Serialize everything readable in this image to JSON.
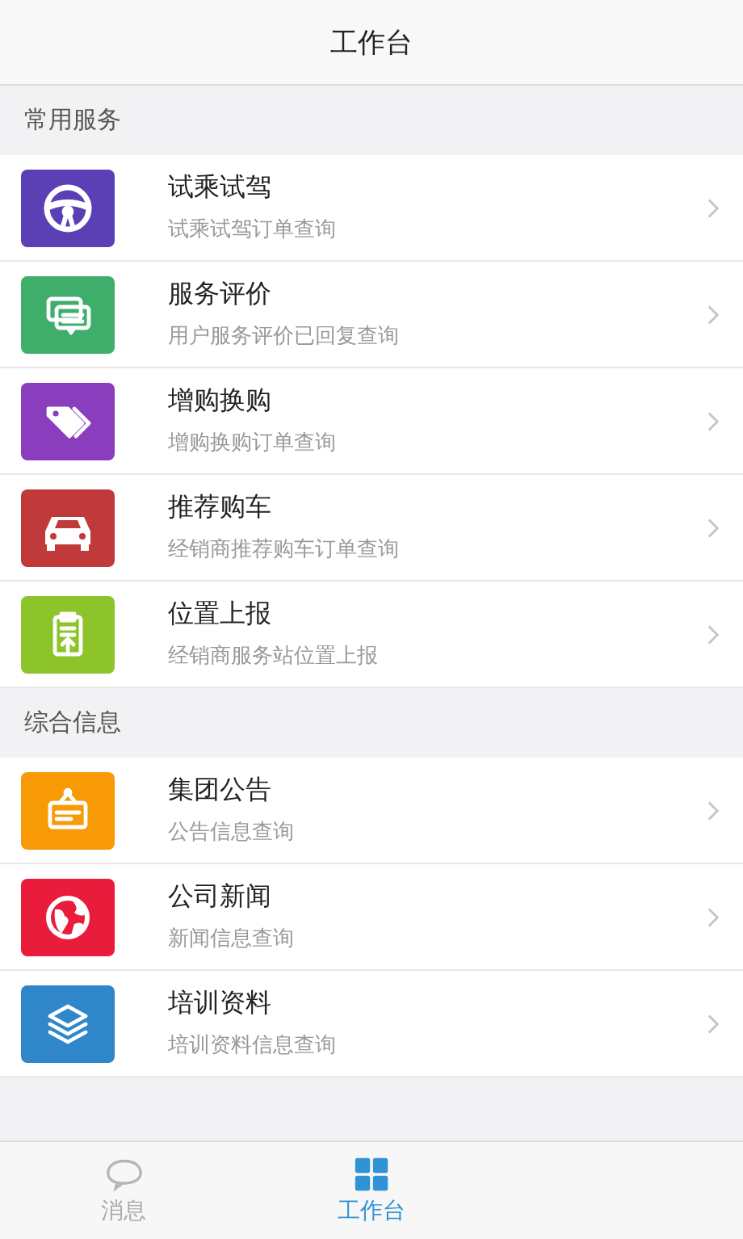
{
  "header": {
    "title": "工作台"
  },
  "sections": [
    {
      "title": "常用服务",
      "items": [
        {
          "title": "试乘试驾",
          "subtitle": "试乘试驾订单查询",
          "color": "#5b3fb5"
        },
        {
          "title": "服务评价",
          "subtitle": "用户服务评价已回复查询",
          "color": "#3fae6a"
        },
        {
          "title": "增购换购",
          "subtitle": "增购换购订单查询",
          "color": "#8a3dbd"
        },
        {
          "title": "推荐购车",
          "subtitle": "经销商推荐购车订单查询",
          "color": "#c0393b"
        },
        {
          "title": "位置上报",
          "subtitle": "经销商服务站位置上报",
          "color": "#8cc42a"
        }
      ]
    },
    {
      "title": "综合信息",
      "items": [
        {
          "title": "集团公告",
          "subtitle": "公告信息查询",
          "color": "#f79a06"
        },
        {
          "title": "公司新闻",
          "subtitle": "新闻信息查询",
          "color": "#ea1c3c"
        },
        {
          "title": "培训资料",
          "subtitle": "培训资料信息查询",
          "color": "#2f86c9"
        }
      ]
    }
  ],
  "tabs": [
    {
      "label": "消息",
      "selected": false
    },
    {
      "label": "工作台",
      "selected": true
    }
  ]
}
